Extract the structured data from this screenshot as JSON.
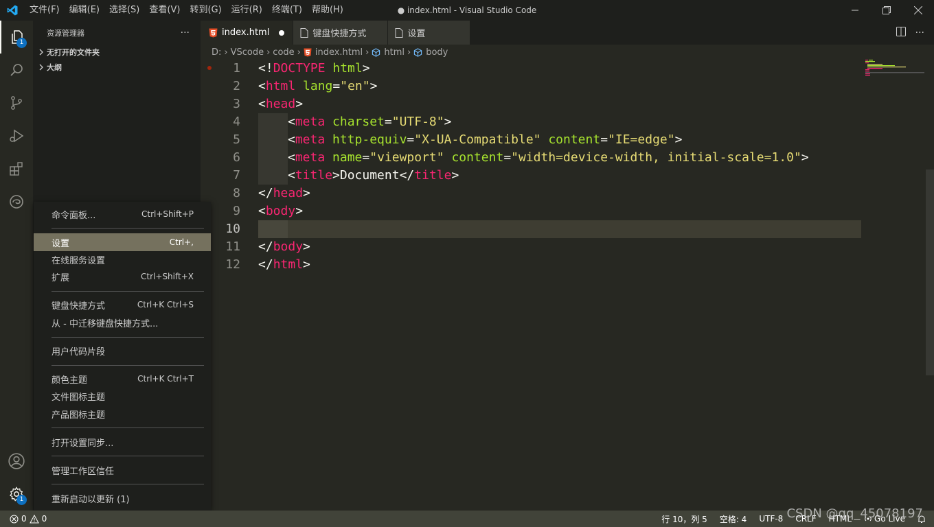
{
  "window": {
    "title": "● index.html - Visual Studio Code",
    "menu": [
      "文件(F)",
      "编辑(E)",
      "选择(S)",
      "查看(V)",
      "转到(G)",
      "运行(R)",
      "终端(T)",
      "帮助(H)"
    ]
  },
  "activity_bar": {
    "explorer_badge": "1",
    "manage_badge": "1"
  },
  "sidebar": {
    "title": "资源管理器",
    "more": "···",
    "sections": [
      "无打开的文件夹",
      "大纲"
    ]
  },
  "tabs": [
    {
      "label": "index.html",
      "active": true,
      "dirty": true,
      "icon": "html5-icon"
    },
    {
      "label": "键盘快捷方式",
      "active": false,
      "icon": "file-icon"
    },
    {
      "label": "设置",
      "active": false,
      "icon": "file-icon"
    }
  ],
  "breadcrumb": [
    "D:",
    "VScode",
    "code",
    "index.html",
    "html",
    "body"
  ],
  "editor": {
    "current_line": 10,
    "lines": [
      {
        "n": "1"
      },
      {
        "n": "2"
      },
      {
        "n": "3"
      },
      {
        "n": "4"
      },
      {
        "n": "5"
      },
      {
        "n": "6"
      },
      {
        "n": "7"
      },
      {
        "n": "8"
      },
      {
        "n": "9"
      },
      {
        "n": "10"
      },
      {
        "n": "11"
      },
      {
        "n": "12"
      }
    ],
    "tokens": {
      "l1": [
        "<!",
        "DOCTYPE",
        " html",
        ">"
      ],
      "l2": [
        "<",
        "html",
        " lang",
        "=",
        "\"en\"",
        ">"
      ],
      "l3": [
        "<",
        "head",
        ">"
      ],
      "l4": [
        "<",
        "meta",
        " charset",
        "=",
        "\"UTF-8\"",
        ">"
      ],
      "l5": [
        "<",
        "meta",
        " http-equiv",
        "=",
        "\"X-UA-Compatible\"",
        " content",
        "=",
        "\"IE=edge\"",
        ">"
      ],
      "l6": [
        "<",
        "meta",
        " name",
        "=",
        "\"viewport\"",
        " content",
        "=",
        "\"width=device-width, initial-scale=1.0\"",
        ">"
      ],
      "l7": [
        "<",
        "title",
        ">",
        "Document",
        "</",
        "title",
        ">"
      ],
      "l8": [
        "</",
        "head",
        ">"
      ],
      "l9": [
        "<",
        "body",
        ">"
      ],
      "l11": [
        "</",
        "body",
        ">"
      ],
      "l12": [
        "</",
        "html",
        ">"
      ]
    }
  },
  "context_menu": {
    "items": [
      {
        "label": "命令面板...",
        "shortcut": "Ctrl+Shift+P"
      },
      {
        "label": "设置",
        "shortcut": "Ctrl+,",
        "highlighted": true
      },
      {
        "label": "在线服务设置",
        "shortcut": ""
      },
      {
        "label": "扩展",
        "shortcut": "Ctrl+Shift+X"
      },
      {
        "label": "键盘快捷方式",
        "shortcut": "Ctrl+K Ctrl+S"
      },
      {
        "label": "从 - 中迁移键盘快捷方式...",
        "shortcut": ""
      },
      {
        "label": "用户代码片段",
        "shortcut": ""
      },
      {
        "label": "颜色主题",
        "shortcut": "Ctrl+K Ctrl+T"
      },
      {
        "label": "文件图标主题",
        "shortcut": ""
      },
      {
        "label": "产品图标主题",
        "shortcut": ""
      },
      {
        "label": "打开设置同步...",
        "shortcut": ""
      },
      {
        "label": "管理工作区信任",
        "shortcut": ""
      },
      {
        "label": "重新启动以更新 (1)",
        "shortcut": ""
      }
    ]
  },
  "status_bar": {
    "errors": "0",
    "warnings": "0",
    "position": "行 10，列 5",
    "spaces": "空格: 4",
    "encoding": "UTF-8",
    "eol": "CRLF",
    "language": "HTML",
    "golive": "Go Live"
  },
  "watermark": "CSDN @qq_45078197",
  "colors": {
    "tag": "#f92672",
    "attribute": "#a6e22e",
    "string": "#e6db74",
    "text": "#f8f8f2",
    "editor_bg": "#272822",
    "statusbar_bg": "#414339",
    "menu_highlight": "#75715e",
    "badge": "#0e70c0"
  }
}
